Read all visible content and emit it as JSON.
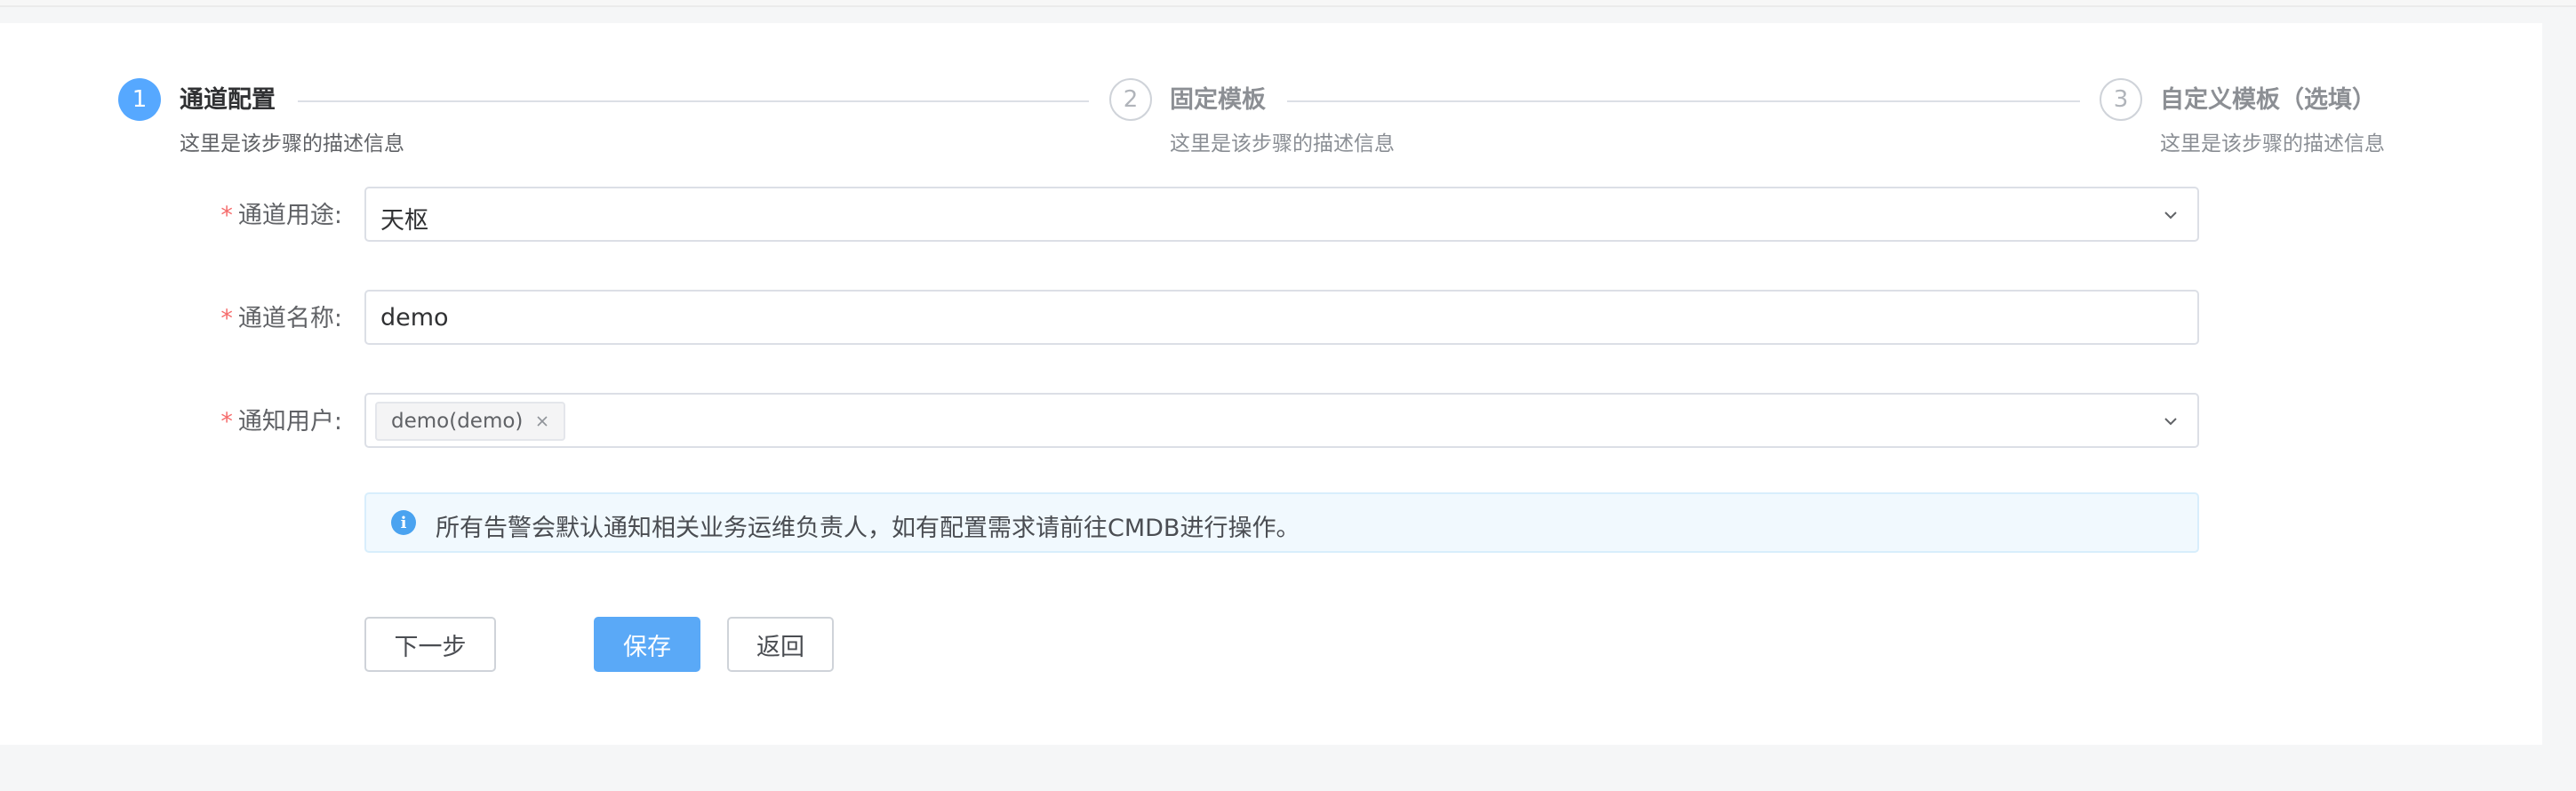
{
  "steps": [
    {
      "number": "1",
      "title": "通道配置",
      "desc": "这里是该步骤的描述信息",
      "state": "active"
    },
    {
      "number": "2",
      "title": "固定模板",
      "desc": "这里是该步骤的描述信息",
      "state": "wait"
    },
    {
      "number": "3",
      "title": "自定义模板（选填）",
      "desc": "这里是该步骤的描述信息",
      "state": "wait"
    }
  ],
  "form": {
    "required_mark": "*",
    "purpose": {
      "label": "通道用途:",
      "value": "天枢"
    },
    "name": {
      "label": "通道名称:",
      "value": "demo"
    },
    "users": {
      "label": "通知用户:",
      "tags": [
        "demo(demo)"
      ]
    }
  },
  "alert": {
    "icon": "info-icon",
    "text": "所有告警会默认通知相关业务运维负责人，如有配置需求请前往CMDB进行操作。"
  },
  "buttons": {
    "next": "下一步",
    "save": "保存",
    "back": "返回"
  },
  "colors": {
    "primary": "#56a8ff",
    "required": "#f56c6c",
    "alert_bg": "#f1f9fe"
  }
}
